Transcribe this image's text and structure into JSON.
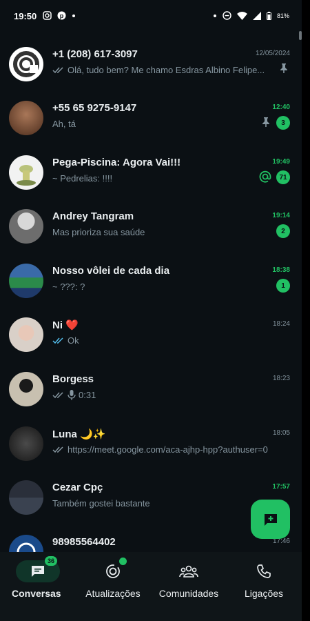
{
  "status_bar": {
    "time": "19:50",
    "battery": "81%"
  },
  "chats": [
    {
      "name": "+1 (208) 617-3097",
      "time": "12/05/2024",
      "preview": "Olá, tudo bem? Me chamo Esdras Albino  Felipe...",
      "ticks": "read-grey",
      "pinned": true,
      "unread": ""
    },
    {
      "name": "+55 65 9275-9147",
      "time": "12:40",
      "preview": "Ah, tá",
      "pinned": true,
      "unread": "3"
    },
    {
      "name": "Pega-Piscina: Agora Vai!!!",
      "time": "19:49",
      "preview": "~ Pedrelias: !!!!",
      "mention": true,
      "unread": "71"
    },
    {
      "name": "Andrey Tangram",
      "time": "19:14",
      "preview": "Mas prioriza sua saúde",
      "unread": "2"
    },
    {
      "name": "Nosso vôlei de cada dia",
      "time": "18:38",
      "preview": "~ ???: ?",
      "unread": "1"
    },
    {
      "name": "Ni ❤️",
      "time": "18:24",
      "preview": "Ok",
      "ticks": "read-blue"
    },
    {
      "name": "Borgess",
      "time": "18:23",
      "preview": "0:31",
      "ticks": "read-grey",
      "voice": true
    },
    {
      "name": "Luna 🌙✨",
      "time": "18:05",
      "preview": "https://meet.google.com/aca-ajhp-hpp?authuser=0",
      "ticks": "read-grey"
    },
    {
      "name": "Cezar Cpç",
      "time": "17:57",
      "preview": "Também gostei bastante",
      "unread_time": true
    },
    {
      "name": "98985564402",
      "time": "17:46",
      "preview": ""
    }
  ],
  "nav": {
    "chats": {
      "label": "Conversas",
      "badge": "36"
    },
    "updates": {
      "label": "Atualizações"
    },
    "communities": {
      "label": "Comunidades"
    },
    "calls": {
      "label": "Ligações"
    }
  },
  "colors": {
    "accent": "#21c063",
    "background": "#0b1014",
    "secondary_text": "#8696a0"
  }
}
